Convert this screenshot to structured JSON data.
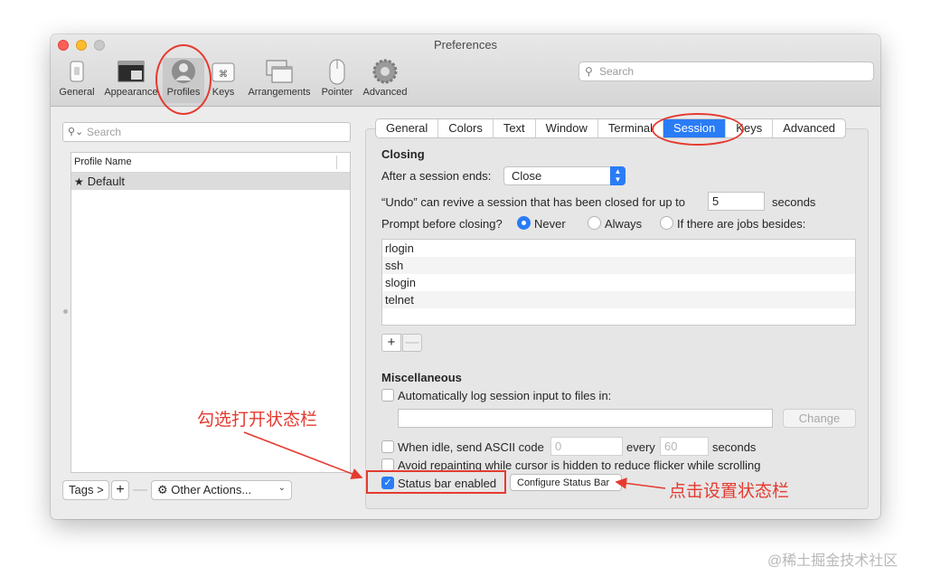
{
  "window": {
    "title": "Preferences"
  },
  "toolbar": {
    "items": [
      {
        "label": "General",
        "icon": "general-icon"
      },
      {
        "label": "Appearance",
        "icon": "appearance-icon"
      },
      {
        "label": "Profiles",
        "icon": "profiles-icon",
        "selected": true
      },
      {
        "label": "Keys",
        "icon": "keys-icon"
      },
      {
        "label": "Arrangements",
        "icon": "arrangements-icon"
      },
      {
        "label": "Pointer",
        "icon": "pointer-icon"
      },
      {
        "label": "Advanced",
        "icon": "gear-icon"
      }
    ],
    "search_placeholder": "Search"
  },
  "profiles": {
    "search_placeholder": "Search",
    "column_header": "Profile Name",
    "items": [
      {
        "name": "Default",
        "star": "★"
      }
    ],
    "tags_label": "Tags >",
    "plus_label": "+",
    "minus_label": "—",
    "other_actions_label": "Other Actions..."
  },
  "tabs": [
    "General",
    "Colors",
    "Text",
    "Window",
    "Terminal",
    "Session",
    "Keys",
    "Advanced"
  ],
  "active_tab": "Session",
  "session": {
    "closing_title": "Closing",
    "after_label": "After a session ends:",
    "after_value": "Close",
    "undo_label": "“Undo” can revive a session that has been closed for up to",
    "undo_value": "5",
    "undo_unit": "seconds",
    "prompt_label": "Prompt before closing?",
    "prompt_options": [
      "Never",
      "Always",
      "If there are jobs besides:"
    ],
    "prompt_selected": "Never",
    "jobs": [
      "rlogin",
      "ssh",
      "slogin",
      "telnet"
    ],
    "jobs_plus": "+",
    "jobs_minus": "—",
    "misc_title": "Miscellaneous",
    "autolog_label": "Automatically log session input to files in:",
    "change_label": "Change",
    "idle_label": "When idle, send ASCII code",
    "idle_code": "0",
    "idle_every": "every",
    "idle_seconds_value": "60",
    "idle_seconds": "seconds",
    "avoid_label": "Avoid repainting while cursor is hidden to reduce flicker while scrolling",
    "statusbar_label": "Status bar enabled",
    "statusbar_checked": true,
    "configure_label": "Configure Status Bar"
  },
  "annotations": {
    "check_note": "勾选打开状态栏",
    "configure_note": "点击设置状态栏"
  },
  "watermark": "@稀土掘金技术社区",
  "colors": {
    "accent": "#2a7cf6",
    "annotation": "#e53a2f"
  }
}
